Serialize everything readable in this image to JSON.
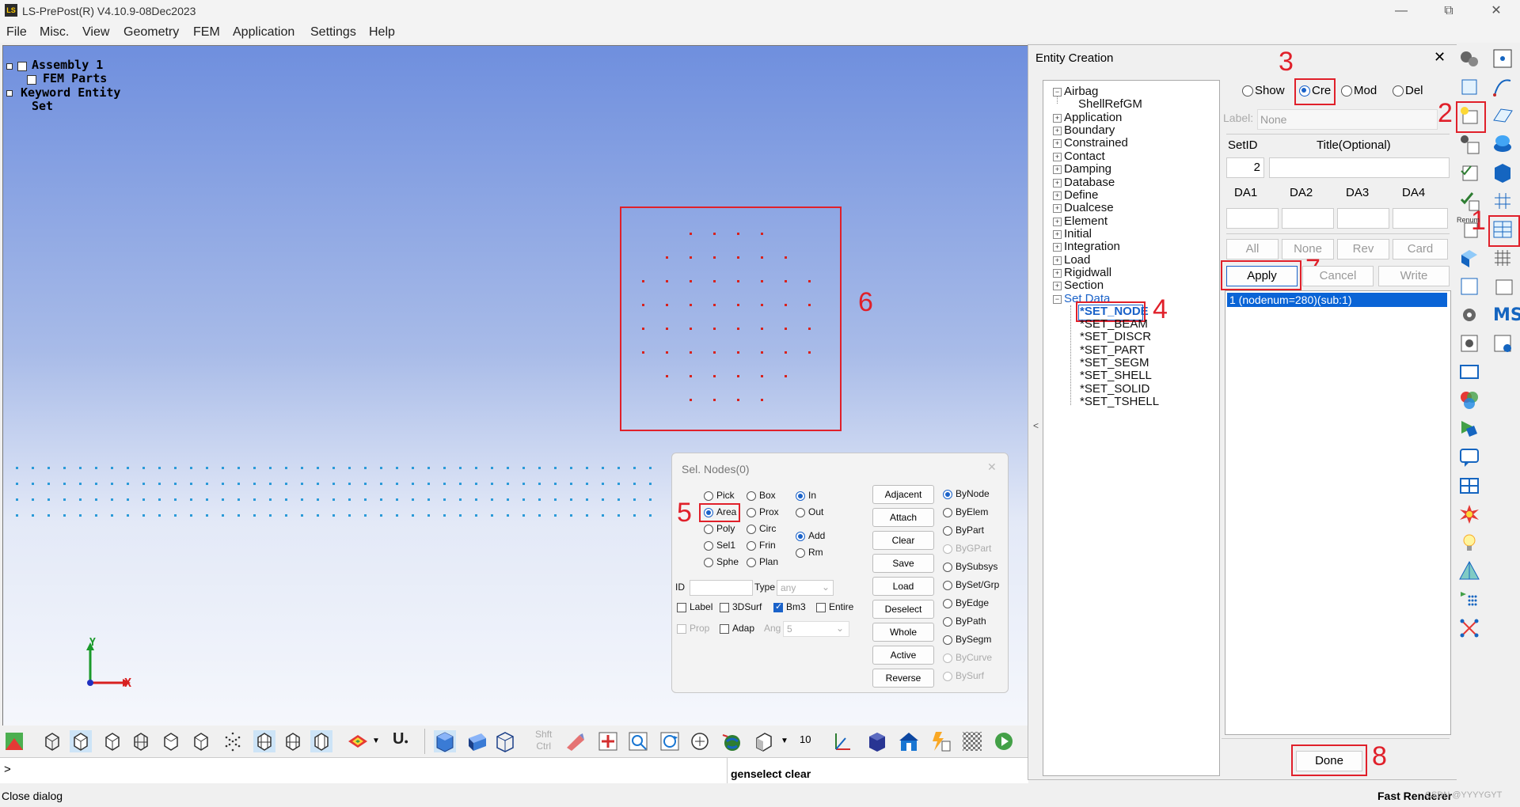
{
  "window": {
    "title": "LS-PrePost(R) V4.10.9-08Dec2023",
    "app_icon_text": "LS"
  },
  "menu": [
    "File",
    "Misc.",
    "View",
    "Geometry",
    "FEM",
    "Application",
    "Settings",
    "Help"
  ],
  "model_tree": {
    "assembly": "Assembly 1",
    "fem_parts": "FEM Parts",
    "keyword_entity": "Keyword Entity",
    "set": "Set"
  },
  "annotations": {
    "n1": "1",
    "n2": "2",
    "n3": "3",
    "n4": "4",
    "n5": "5",
    "n6": "6",
    "n7": "7",
    "n8": "8"
  },
  "axes": {
    "x": "X",
    "y": "Y"
  },
  "sel_nodes": {
    "title": "Sel. Nodes(0)",
    "modes_col1": [
      "Pick",
      "Area",
      "Poly",
      "Sel1",
      "Sphe"
    ],
    "modes_col2": [
      "Box",
      "Prox",
      "Circ",
      "Frin",
      "Plan"
    ],
    "in_label": "In",
    "out_label": "Out",
    "add_label": "Add",
    "rm_label": "Rm",
    "id_label": "ID",
    "type_label": "Type",
    "type_value": "any",
    "checks": [
      "Label",
      "3DSurf",
      "Bm3",
      "Entire"
    ],
    "prop_label": "Prop",
    "adap_label": "Adap",
    "ang_label": "Ang",
    "ang_value": "5",
    "buttons": [
      "Adjacent",
      "Attach",
      "Clear",
      "Save",
      "Load",
      "Deselect",
      "Whole",
      "Active",
      "Reverse"
    ],
    "by_options": [
      "ByNode",
      "ByElem",
      "ByPart",
      "ByGPart",
      "BySubsys",
      "BySet/Grp",
      "ByEdge",
      "ByPath",
      "BySegm",
      "ByCurve",
      "BySurf"
    ]
  },
  "entity": {
    "title": "Entity Creation",
    "tree": [
      "Airbag",
      "ShellRefGM",
      "Application",
      "Boundary",
      "Constrained",
      "Contact",
      "Damping",
      "Database",
      "Define",
      "Dualcese",
      "Element",
      "Initial",
      "Integration",
      "Load",
      "Rigidwall",
      "Section",
      "Set Data"
    ],
    "set_items": [
      "*SET_NODE",
      "*SET_BEAM",
      "*SET_DISCR",
      "*SET_PART",
      "*SET_SEGM",
      "*SET_SHELL",
      "*SET_SOLID",
      "*SET_TSHELL"
    ],
    "modes": [
      "Show",
      "Cre",
      "Mod",
      "Del"
    ],
    "label_label": "Label:",
    "label_value": "None",
    "setid_label": "SetID",
    "title_label": "Title(Optional)",
    "setid_value": "2",
    "da": [
      "DA1",
      "DA2",
      "DA3",
      "DA4"
    ],
    "sel_buttons": [
      "All",
      "None",
      "Rev",
      "Card"
    ],
    "apply": "Apply",
    "cancel": "Cancel",
    "write": "Write",
    "list_item": "1 (nodenum=280)(sub:1)",
    "done": "Done",
    "collapse_arrow": "<"
  },
  "bottom": {
    "shft": "Shft",
    "ctrl": "Ctrl",
    "number": "10",
    "prompt": ">",
    "command": "genselect clear"
  },
  "status": {
    "left": "Close dialog",
    "right": "Fast Renderer",
    "watermark": "CSDN @YYYYGYT"
  },
  "colors": {
    "accent": "#1a62c9",
    "annotation": "#e0202a",
    "node": "#d8221e"
  }
}
